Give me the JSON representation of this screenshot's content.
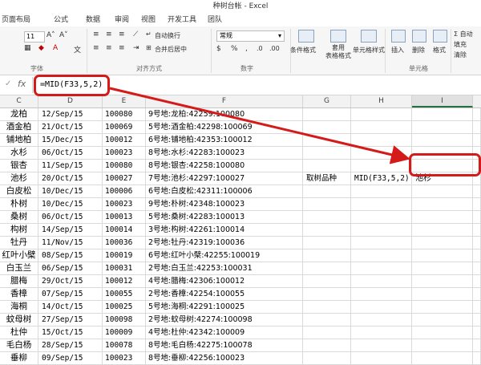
{
  "window": {
    "title": "种树台帐 - Excel"
  },
  "tabs": [
    "页面布局",
    "公式",
    "数据",
    "审阅",
    "视图",
    "开发工具",
    "团队"
  ],
  "ribbon": {
    "font_size": "11",
    "wrap_text": "自动换行",
    "merge_center": "合并后居中",
    "number_format": "常规",
    "conditional_format": "条件格式",
    "format_as_table": "套用\n表格格式",
    "cell_styles": "单元格样式",
    "insert": "插入",
    "delete": "删除",
    "format": "格式",
    "autosum": "Σ 自动",
    "fill": "填充",
    "clear": "清除",
    "group_font": "字体",
    "group_alignment": "对齐方式",
    "group_number": "数字",
    "group_cells": "单元格"
  },
  "formula_bar": {
    "fx": "fx",
    "formula": "=MID(F33,5,2)"
  },
  "columns": [
    "C",
    "D",
    "E",
    "F",
    "G",
    "H",
    "I"
  ],
  "rows": [
    {
      "a": "龙柏",
      "d": "12/Sep/15",
      "e": "100080",
      "f": "9号地:龙柏:42259:100080",
      "g": "",
      "h": "",
      "i": ""
    },
    {
      "a": "酒金柏",
      "d": "21/Oct/15",
      "e": "100069",
      "f": "5号地:酒金柏:42298:100069",
      "g": "",
      "h": "",
      "i": ""
    },
    {
      "a": "铺地柏",
      "d": "15/Dec/15",
      "e": "100012",
      "f": "6号地:铺地柏:42353:100012",
      "g": "",
      "h": "",
      "i": ""
    },
    {
      "a": "水杉",
      "d": "06/Oct/15",
      "e": "100023",
      "f": "8号地:水杉:42283:100023",
      "g": "",
      "h": "",
      "i": ""
    },
    {
      "a": "银杏",
      "d": "11/Sep/15",
      "e": "100080",
      "f": "8号地:银杏:42258:100080",
      "g": "",
      "h": "",
      "i": ""
    },
    {
      "a": "池杉",
      "d": "20/Oct/15",
      "e": "100027",
      "f": "7号地:池杉:42297:100027",
      "g": "取树品种",
      "h": "MID(F33,5,2)",
      "i": "池杉"
    },
    {
      "a": "白皮松",
      "d": "10/Dec/15",
      "e": "100006",
      "f": "6号地:白皮松:42311:100006",
      "g": "",
      "h": "",
      "i": ""
    },
    {
      "a": "朴树",
      "d": "10/Dec/15",
      "e": "100023",
      "f": "9号地:朴树:42348:100023",
      "g": "",
      "h": "",
      "i": ""
    },
    {
      "a": "桑树",
      "d": "06/Oct/15",
      "e": "100013",
      "f": "5号地:桑树:42283:100013",
      "g": "",
      "h": "",
      "i": ""
    },
    {
      "a": "构树",
      "d": "14/Sep/15",
      "e": "100014",
      "f": "3号地:构树:42261:100014",
      "g": "",
      "h": "",
      "i": ""
    },
    {
      "a": "牡丹",
      "d": "11/Nov/15",
      "e": "100036",
      "f": "2号地:牡丹:42319:100036",
      "g": "",
      "h": "",
      "i": ""
    },
    {
      "a": "红叶小檗",
      "d": "08/Sep/15",
      "e": "100019",
      "f": "6号地:红叶小檗:42255:100019",
      "g": "",
      "h": "",
      "i": ""
    },
    {
      "a": "白玉兰",
      "d": "06/Sep/15",
      "e": "100031",
      "f": "2号地:白玉兰:42253:100031",
      "g": "",
      "h": "",
      "i": ""
    },
    {
      "a": "腊梅",
      "d": "29/Oct/15",
      "e": "100012",
      "f": "4号地:腊梅:42306:100012",
      "g": "",
      "h": "",
      "i": ""
    },
    {
      "a": "香樟",
      "d": "07/Sep/15",
      "e": "100055",
      "f": "2号地:香樟:42254:100055",
      "g": "",
      "h": "",
      "i": ""
    },
    {
      "a": "海桐",
      "d": "14/Oct/15",
      "e": "100025",
      "f": "5号地:海桐:42291:100025",
      "g": "",
      "h": "",
      "i": ""
    },
    {
      "a": "蚊母树",
      "d": "27/Sep/15",
      "e": "100098",
      "f": "2号地:蚊母树:42274:100098",
      "g": "",
      "h": "",
      "i": ""
    },
    {
      "a": "杜仲",
      "d": "15/Oct/15",
      "e": "100009",
      "f": "4号地:杜仲:42342:100009",
      "g": "",
      "h": "",
      "i": ""
    },
    {
      "a": "毛白杨",
      "d": "28/Sep/15",
      "e": "100078",
      "f": "8号地:毛白杨:42275:100078",
      "g": "",
      "h": "",
      "i": ""
    },
    {
      "a": "垂柳",
      "d": "09/Sep/15",
      "e": "100023",
      "f": "8号地:垂柳:42256:100023",
      "g": "",
      "h": "",
      "i": ""
    }
  ],
  "colors": {
    "accent": "#217346",
    "callout": "#d51a1a",
    "ribbon_bg": "#f6f6f6"
  }
}
